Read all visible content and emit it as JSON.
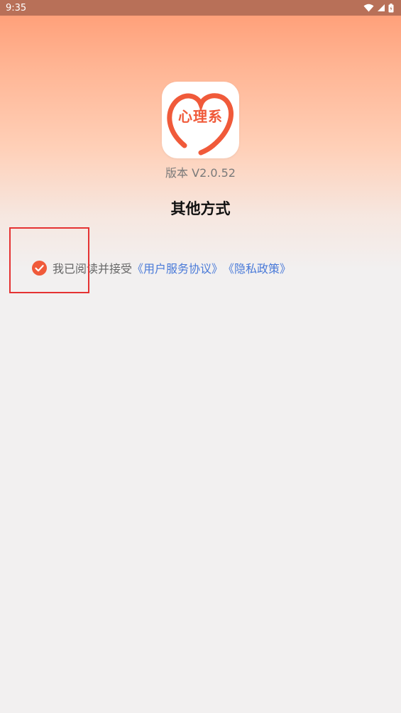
{
  "status_bar": {
    "time": "9:35"
  },
  "app": {
    "logo_text": "心理系",
    "version": "版本 V2.0.52"
  },
  "page": {
    "title": "其他方式"
  },
  "agreement": {
    "prefix": "我已阅读并接受",
    "terms_link": "《用户服务协议》",
    "privacy_link": "《隐私政策》",
    "checked": true
  },
  "colors": {
    "accent": "#f05a3a",
    "link": "#4a7ad8",
    "status_bar": "#b87058"
  }
}
